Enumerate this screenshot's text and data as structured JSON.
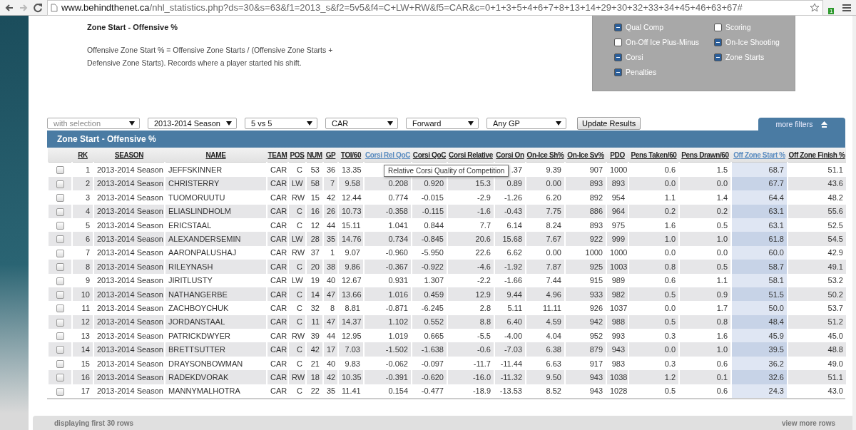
{
  "browser": {
    "url_host": "www.behindthenet.ca",
    "url_path": "/nhl_statistics.php?ds=30&s=63&f1=2013_s&f2=5v5&f4=C+LW+RW&f5=CAR&c=0+1+3+5+4+6+7+8+13+14+29+30+32+33+34+45+46+63+67#",
    "extension_badge": "1"
  },
  "intro": {
    "title": "Zone Start - Offensive %",
    "description": "Offensive Zone Start % = Offensive Zone Starts / (Offensive Zone Starts + Defensive Zone Starts). Records where a player started his shift."
  },
  "filter_panel": [
    {
      "label": "Qual Comp",
      "checked": true
    },
    {
      "label": "Scoring",
      "checked": false
    },
    {
      "label": "On-Off Ice Plus-Minus",
      "checked": false
    },
    {
      "label": "On-Ice Shooting",
      "checked": true
    },
    {
      "label": "Corsi",
      "checked": true
    },
    {
      "label": "Zone Starts",
      "checked": true
    },
    {
      "label": "Penalties",
      "checked": true
    }
  ],
  "toolbar": {
    "selects": [
      {
        "placeholder": "with selection"
      },
      {
        "value": "2013-2014 Season"
      },
      {
        "value": "5 vs 5"
      },
      {
        "value": "CAR"
      },
      {
        "value": "Forward"
      },
      {
        "value": "Any GP"
      }
    ],
    "update_button": "Update Results",
    "more_filters": "more filters"
  },
  "table": {
    "title": "Zone Start - Offensive %",
    "columns": [
      {
        "label": "RK",
        "sorted": false,
        "hovered": false
      },
      {
        "label": "SEASON",
        "sorted": false,
        "hovered": false
      },
      {
        "label": "NAME",
        "sorted": false,
        "hovered": false
      },
      {
        "label": "TEAM",
        "sorted": false,
        "hovered": false
      },
      {
        "label": "POS",
        "sorted": false,
        "hovered": false
      },
      {
        "label": "NUM",
        "sorted": false,
        "hovered": false
      },
      {
        "label": "GP",
        "sorted": false,
        "hovered": false
      },
      {
        "label": "TOI/60",
        "sorted": false,
        "hovered": false
      },
      {
        "label": "Corsi Rel QoC",
        "sorted": false,
        "hovered": true
      },
      {
        "label": "Corsi QoC",
        "sorted": false,
        "hovered": false
      },
      {
        "label": "Corsi Relative",
        "sorted": false,
        "hovered": false
      },
      {
        "label": "Corsi On",
        "sorted": false,
        "hovered": false
      },
      {
        "label": "On-Ice Sh%",
        "sorted": false,
        "hovered": false
      },
      {
        "label": "On-Ice Sv%",
        "sorted": false,
        "hovered": false
      },
      {
        "label": "PDO",
        "sorted": false,
        "hovered": false
      },
      {
        "label": "Pens Taken/60",
        "sorted": false,
        "hovered": false
      },
      {
        "label": "Pens Drawn/60",
        "sorted": false,
        "hovered": false
      },
      {
        "label": "Off Zone Start %",
        "sorted": true,
        "hovered": false
      },
      {
        "label": "Off Zone Finish %",
        "sorted": false,
        "hovered": false
      }
    ],
    "rows": [
      {
        "checked": false,
        "cells": [
          "1",
          "2013-2014 Season",
          "JEFFSKINNER",
          "CAR",
          "C",
          "53",
          "36",
          "13.35",
          null,
          null,
          null,
          ".37",
          "9.39",
          "907",
          "1000",
          "0.6",
          "1.5",
          "68.7",
          "51.1"
        ]
      },
      {
        "checked": false,
        "cells": [
          "2",
          "2013-2014 Season",
          "CHRISTERRY",
          "CAR",
          "LW",
          "58",
          "7",
          "9.58",
          "0.208",
          "0.920",
          "15.3",
          "0.89",
          "0.00",
          "893",
          "893",
          "0.0",
          "0.0",
          "67.7",
          "43.6"
        ]
      },
      {
        "checked": false,
        "cells": [
          "3",
          "2013-2014 Season",
          "TUOMORUUTU",
          "CAR",
          "RW",
          "15",
          "42",
          "12.44",
          "0.774",
          "-0.015",
          "-2.9",
          "-1.26",
          "6.20",
          "892",
          "954",
          "1.1",
          "1.4",
          "64.4",
          "48.2"
        ]
      },
      {
        "checked": false,
        "cells": [
          "4",
          "2013-2014 Season",
          "ELIASLINDHOLM",
          "CAR",
          "C",
          "16",
          "26",
          "10.73",
          "-0.358",
          "-0.115",
          "-1.6",
          "-0.43",
          "7.75",
          "886",
          "964",
          "0.2",
          "0.2",
          "63.1",
          "55.6"
        ]
      },
      {
        "checked": false,
        "cells": [
          "5",
          "2013-2014 Season",
          "ERICSTAAL",
          "CAR",
          "C",
          "12",
          "44",
          "15.11",
          "1.041",
          "0.844",
          "7.7",
          "6.14",
          "8.24",
          "893",
          "975",
          "1.6",
          "0.5",
          "63.1",
          "52.5"
        ]
      },
      {
        "checked": false,
        "cells": [
          "6",
          "2013-2014 Season",
          "ALEXANDERSEMIN",
          "CAR",
          "LW",
          "28",
          "35",
          "14.76",
          "0.734",
          "-0.845",
          "20.6",
          "15.68",
          "7.67",
          "922",
          "999",
          "1.0",
          "1.0",
          "61.8",
          "54.5"
        ]
      },
      {
        "checked": false,
        "cells": [
          "7",
          "2013-2014 Season",
          "AARONPALUSHAJ",
          "CAR",
          "RW",
          "37",
          "1",
          "9.07",
          "-0.960",
          "-5.950",
          "22.6",
          "6.62",
          "0.00",
          "1000",
          "1000",
          "0.0",
          "0.0",
          "60.0",
          "42.9"
        ]
      },
      {
        "checked": false,
        "cells": [
          "8",
          "2013-2014 Season",
          "RILEYNASH",
          "CAR",
          "C",
          "20",
          "38",
          "9.86",
          "-0.367",
          "-0.922",
          "-4.6",
          "-1.92",
          "7.87",
          "925",
          "1003",
          "0.8",
          "0.5",
          "58.7",
          "49.1"
        ]
      },
      {
        "checked": false,
        "cells": [
          "9",
          "2013-2014 Season",
          "JIRITLUSTY",
          "CAR",
          "LW",
          "19",
          "40",
          "12.67",
          "0.931",
          "1.307",
          "-2.2",
          "-1.66",
          "7.44",
          "915",
          "989",
          "0.6",
          "1.1",
          "58.1",
          "53.2"
        ]
      },
      {
        "checked": false,
        "cells": [
          "10",
          "2013-2014 Season",
          "NATHANGERBE",
          "CAR",
          "C",
          "14",
          "47",
          "13.66",
          "1.016",
          "0.459",
          "12.9",
          "9.44",
          "4.96",
          "933",
          "982",
          "0.5",
          "0.9",
          "51.5",
          "50.2"
        ]
      },
      {
        "checked": false,
        "cells": [
          "11",
          "2013-2014 Season",
          "ZACHBOYCHUK",
          "CAR",
          "C",
          "32",
          "8",
          "8.81",
          "-0.871",
          "-6.245",
          "2.8",
          "5.11",
          "11.11",
          "926",
          "1037",
          "0.0",
          "1.7",
          "50.0",
          "53.7"
        ]
      },
      {
        "checked": false,
        "cells": [
          "12",
          "2013-2014 Season",
          "JORDANSTAAL",
          "CAR",
          "C",
          "11",
          "47",
          "14.37",
          "1.102",
          "0.552",
          "8.8",
          "6.40",
          "4.59",
          "942",
          "988",
          "0.5",
          "0.8",
          "48.4",
          "51.2"
        ]
      },
      {
        "checked": false,
        "cells": [
          "13",
          "2013-2014 Season",
          "PATRICKDWYER",
          "CAR",
          "RW",
          "39",
          "44",
          "12.95",
          "1.019",
          "0.665",
          "-5.5",
          "-4.00",
          "4.04",
          "952",
          "993",
          "0.3",
          "1.6",
          "45.9",
          "45.0"
        ]
      },
      {
        "checked": false,
        "cells": [
          "14",
          "2013-2014 Season",
          "BRETTSUTTER",
          "CAR",
          "C",
          "42",
          "17",
          "7.03",
          "-1.502",
          "-1.638",
          "-0.6",
          "-7.03",
          "6.38",
          "879",
          "943",
          "0.0",
          "1.0",
          "39.5",
          "48.8"
        ]
      },
      {
        "checked": false,
        "cells": [
          "15",
          "2013-2014 Season",
          "DRAYSONBOWMAN",
          "CAR",
          "C",
          "21",
          "40",
          "9.83",
          "-0.062",
          "-0.097",
          "-11.7",
          "-11.44",
          "6.63",
          "917",
          "983",
          "0.3",
          "0.6",
          "36.2",
          "49.0"
        ]
      },
      {
        "checked": false,
        "cells": [
          "16",
          "2013-2014 Season",
          "RADEKDVORAK",
          "CAR",
          "RW",
          "18",
          "42",
          "10.35",
          "-0.391",
          "-0.620",
          "-16.0",
          "-11.32",
          "9.50",
          "943",
          "1038",
          "1.2",
          "0.1",
          "32.6",
          "51.1"
        ]
      },
      {
        "checked": false,
        "cells": [
          "17",
          "2013-2014 Season",
          "MANNYMALHOTRA",
          "CAR",
          "C",
          "22",
          "35",
          "11.41",
          "0.154",
          "-0.477",
          "-18.9",
          "-13.53",
          "8.52",
          "943",
          "1028",
          "0.5",
          "0.6",
          "24.3",
          "43.0"
        ]
      }
    ],
    "tooltip": "Relative Corsi Quality of Competition"
  },
  "footer": {
    "status": "displaying first 30 rows",
    "more_link": "view more rows"
  }
}
